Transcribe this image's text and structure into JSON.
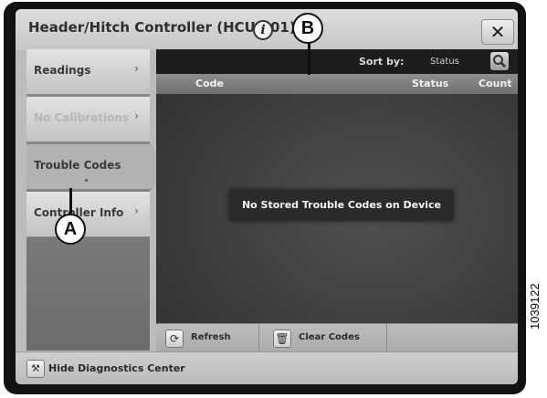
{
  "window": {
    "title": "Header/Hitch Controller (HCU.001)",
    "close_icon": "x-icon",
    "info_icon": "info-icon"
  },
  "sidebar": {
    "items": [
      {
        "label": "Readings",
        "state": "normal"
      },
      {
        "label": "No Calibrations",
        "state": "disabled"
      },
      {
        "label": "Trouble Codes",
        "state": "selected"
      },
      {
        "label": "Controller Info",
        "state": "normal"
      }
    ]
  },
  "sortbar": {
    "label": "Sort by:",
    "value": "Status",
    "search_icon": "magnifier-icon"
  },
  "table": {
    "columns": [
      "Code",
      "Status",
      "Count"
    ],
    "rows": []
  },
  "empty_message": "No Stored Trouble Codes on Device",
  "actions": {
    "refresh_label": "Refresh",
    "clear_label": "Clear Codes"
  },
  "footer": {
    "hide_label": "Hide Diagnostics Center"
  },
  "callouts": {
    "a": "A",
    "b": "B"
  },
  "figure_id": "1039122"
}
